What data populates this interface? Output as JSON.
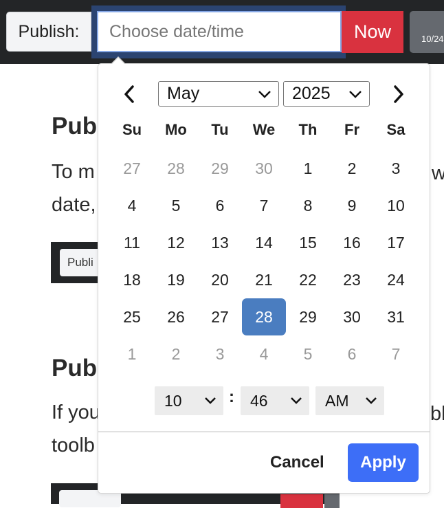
{
  "toolbar": {
    "publish_label": "Publish:",
    "date_placeholder": "Choose date/time",
    "date_value": "",
    "now_label": "Now",
    "partial_chip_text": "10/24"
  },
  "article": {
    "heading1": "Pub",
    "para1_line1": "To m",
    "para1_line1_right": "w",
    "para1_line2": "date,",
    "mini1_label": "Publi",
    "heading2": "Pub",
    "para2_line1": "If you",
    "para2_line1_right": "bl",
    "para2_line2": "toolb"
  },
  "calendar": {
    "month": "May",
    "year": "2025",
    "weekdays": [
      "Su",
      "Mo",
      "Tu",
      "We",
      "Th",
      "Fr",
      "Sa"
    ],
    "weeks": [
      [
        "27",
        "28",
        "29",
        "30",
        "1",
        "2",
        "3"
      ],
      [
        "4",
        "5",
        "6",
        "7",
        "8",
        "9",
        "10"
      ],
      [
        "11",
        "12",
        "13",
        "14",
        "15",
        "16",
        "17"
      ],
      [
        "18",
        "19",
        "20",
        "21",
        "22",
        "23",
        "24"
      ],
      [
        "25",
        "26",
        "27",
        "28",
        "29",
        "30",
        "31"
      ],
      [
        "1",
        "2",
        "3",
        "4",
        "5",
        "6",
        "7"
      ]
    ],
    "selected_day": "28",
    "time": {
      "hour": "10",
      "separator": ":",
      "minute": "46",
      "ampm": "AM"
    },
    "cancel_label": "Cancel",
    "apply_label": "Apply"
  },
  "colors": {
    "toolbar_bg": "#232527",
    "now_button": "#d9323f",
    "selected_day_bg": "#4a7dc0",
    "apply_button": "#3d6ef7",
    "focus_ring": "#2b4471"
  },
  "icons": {
    "prev_month": "chevron-left-icon",
    "next_month": "chevron-right-icon",
    "dropdown": "chevron-down-icon"
  }
}
